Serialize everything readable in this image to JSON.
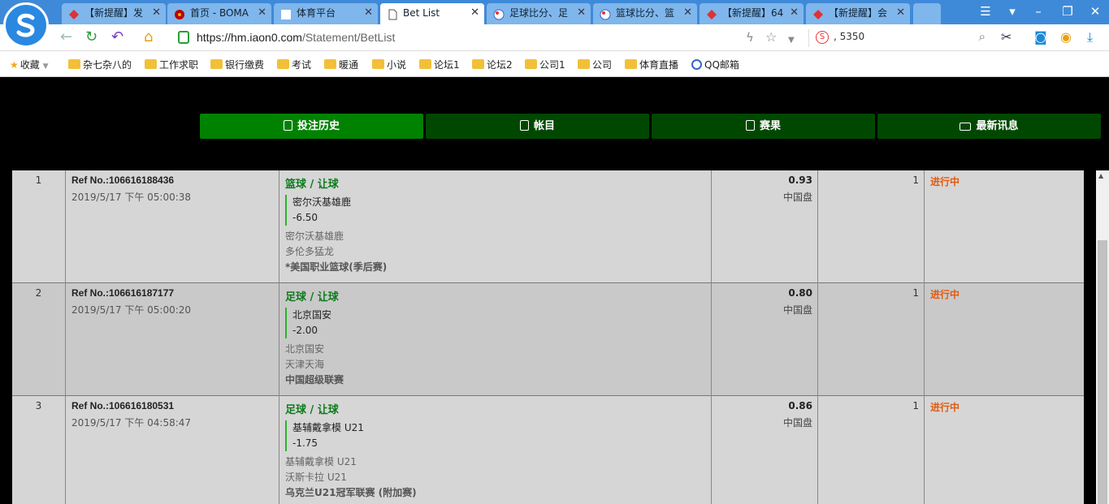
{
  "tabs": [
    {
      "label": "【新提醒】发",
      "active": false,
      "icon": "diamond-icon"
    },
    {
      "label": "首页 - BOMA",
      "active": false,
      "icon": "gear-icon"
    },
    {
      "label": "体育平台",
      "active": false,
      "icon": "blank-page-icon"
    },
    {
      "label": "Bet List",
      "active": true,
      "icon": "document-icon"
    },
    {
      "label": "足球比分、足",
      "active": false,
      "icon": "ball-icon"
    },
    {
      "label": "篮球比分、篮",
      "active": false,
      "icon": "ball-icon"
    },
    {
      "label": "【新提醒】64",
      "active": false,
      "icon": "diamond-icon"
    },
    {
      "label": "【新提醒】会",
      "active": false,
      "icon": "diamond-icon"
    }
  ],
  "address": {
    "prefix": "https://hm.iaon0.com",
    "path": "/Statement/BetList"
  },
  "search": {
    "value": ", 5350"
  },
  "bookmarks": [
    {
      "label": "收藏",
      "type": "star"
    },
    {
      "label": "杂七杂八的",
      "type": "folder"
    },
    {
      "label": "工作求职",
      "type": "folder"
    },
    {
      "label": "银行缴费",
      "type": "folder"
    },
    {
      "label": "考试",
      "type": "folder"
    },
    {
      "label": "暖通",
      "type": "folder"
    },
    {
      "label": "小说",
      "type": "folder"
    },
    {
      "label": "论坛1",
      "type": "folder"
    },
    {
      "label": "论坛2",
      "type": "folder"
    },
    {
      "label": "公司1",
      "type": "folder"
    },
    {
      "label": "公司",
      "type": "folder"
    },
    {
      "label": "体育直播",
      "type": "folder"
    },
    {
      "label": "QQ邮箱",
      "type": "qq"
    }
  ],
  "nav": [
    {
      "label": "投注历史",
      "active": true
    },
    {
      "label": "帐目",
      "active": false
    },
    {
      "label": "赛果",
      "active": false
    },
    {
      "label": "最新讯息",
      "active": false
    }
  ],
  "bets": [
    {
      "num": "1",
      "ref": "Ref No.:106616188436",
      "datetime": "2019/5/17 下午 05:00:38",
      "sport": "篮球 / 让球",
      "pick": "密尔沃基雄鹿",
      "line": "-6.50",
      "home": "密尔沃基雄鹿",
      "away": "多伦多猛龙",
      "league": "*美国职业篮球(季后赛)",
      "odds": "0.93",
      "market": "中国盘",
      "stake": "1",
      "status": "进行中"
    },
    {
      "num": "2",
      "ref": "Ref No.:106616187177",
      "datetime": "2019/5/17 下午 05:00:20",
      "sport": "足球 / 让球",
      "pick": "北京国安",
      "line": "-2.00",
      "home": "北京国安",
      "away": "天津天海",
      "league": "中国超级联赛",
      "odds": "0.80",
      "market": "中国盘",
      "stake": "1",
      "status": "进行中"
    },
    {
      "num": "3",
      "ref": "Ref No.:106616180531",
      "datetime": "2019/5/17 下午 04:58:47",
      "sport": "足球 / 让球",
      "pick": "基辅戴拿模 U21",
      "line": "-1.75",
      "home": "基辅戴拿模 U21",
      "away": "沃斯卡拉 U21",
      "league": "乌克兰U21冠军联赛 (附加赛)",
      "odds": "0.86",
      "market": "中国盘",
      "stake": "1",
      "status": "进行中"
    }
  ],
  "colors": {
    "active_nav": "#008200",
    "nav": "#004800",
    "status": "#e35a10",
    "sport": "#0d7a1c"
  }
}
